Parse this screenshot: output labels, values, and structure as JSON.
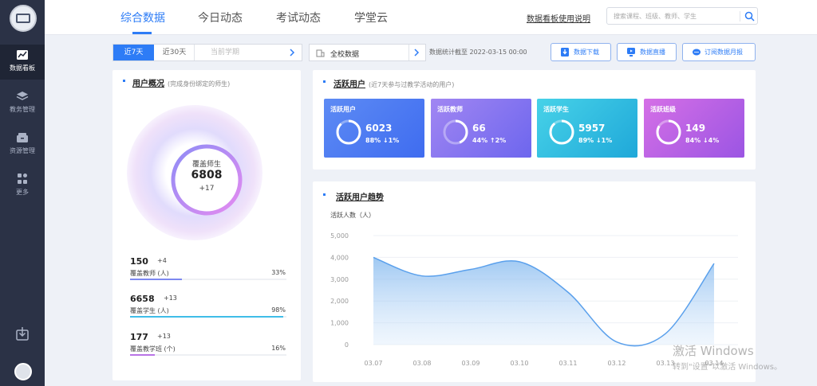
{
  "nav": {
    "tabs": [
      {
        "label": "综合数据"
      },
      {
        "label": "今日动态"
      },
      {
        "label": "考试动态"
      },
      {
        "label": "学堂云"
      }
    ],
    "help_link": "数据看板使用说明",
    "search_placeholder": "搜索课程、班级、教师、学生"
  },
  "sidebar": {
    "items": [
      {
        "label": "数据看板",
        "icon": "trend-chart-icon"
      },
      {
        "label": "教务管理",
        "icon": "layers-icon"
      },
      {
        "label": "资源管理",
        "icon": "box-icon"
      },
      {
        "label": "更多",
        "icon": "grid-icon"
      }
    ]
  },
  "filters": {
    "range_options": [
      "近7天",
      "近30天"
    ],
    "selected_range": "近7天",
    "semester_placeholder": "当前学期",
    "scope": "全校数据",
    "stat_note": "数据统计截至 2022-03-15 00:00"
  },
  "actions": {
    "download": "数据下载",
    "live": "数据直播",
    "subscribe": "订阅数据月报"
  },
  "overview": {
    "title": "用户概况",
    "subtitle": "(完成身份绑定的师生)",
    "center_label": "覆盖师生",
    "center_value": "6808",
    "center_delta": "+17",
    "stats": [
      {
        "value": "150",
        "delta": "+4",
        "label": "覆盖教师 (人)",
        "percent": "33%",
        "fill": 0.33,
        "color": "#7d88f0"
      },
      {
        "value": "6658",
        "delta": "+13",
        "label": "覆盖学生 (人)",
        "percent": "98%",
        "fill": 0.98,
        "color": "#3fbde8"
      },
      {
        "value": "177",
        "delta": "+13",
        "label": "覆盖教学班 (个)",
        "percent": "16%",
        "fill": 0.16,
        "color": "#b873e6"
      }
    ]
  },
  "active": {
    "title": "活跃用户",
    "subtitle": "(近7天参与过教学活动的用户)",
    "metrics": [
      {
        "title": "活跃用户",
        "value": "6023",
        "sub": "88% ↓1%",
        "fill": 0.88
      },
      {
        "title": "活跃教师",
        "value": "66",
        "sub": "44% ↑2%",
        "fill": 0.44
      },
      {
        "title": "活跃学生",
        "value": "5957",
        "sub": "89% ↓1%",
        "fill": 0.89
      },
      {
        "title": "活跃班级",
        "value": "149",
        "sub": "84% ↓4%",
        "fill": 0.84
      }
    ]
  },
  "trend": {
    "title": "活跃用户趋势",
    "ylabel": "活跃人数（人）"
  },
  "chart_data": {
    "type": "area",
    "title": "活跃用户趋势",
    "ylabel": "活跃人数（人）",
    "x": [
      "03.07",
      "03.08",
      "03.09",
      "03.10",
      "03.11",
      "03.12",
      "03.13",
      "03.14"
    ],
    "values": [
      4000,
      3150,
      3450,
      3800,
      2400,
      120,
      500,
      3720
    ],
    "ylim": [
      0,
      5000
    ],
    "yticks": [
      "0",
      "1,000",
      "2,000",
      "3,000",
      "4,000",
      "5,000"
    ],
    "grid": true
  },
  "watermark": {
    "line1": "激活 Windows",
    "line2": "转到\"设置\"以激活 Windows。"
  }
}
